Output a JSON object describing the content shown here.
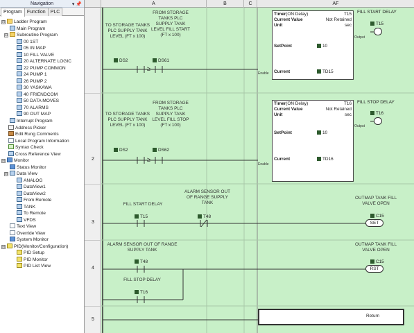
{
  "nav": {
    "title": "Navigation",
    "pin": "▾ 📌",
    "tabs": [
      "Program",
      "Function",
      "PLC"
    ],
    "tree": [
      {
        "label": "Ladder Program",
        "expander": "⊟"
      },
      {
        "label": "Main Program"
      },
      {
        "label": "Subroutine Program",
        "expander": "⊟"
      },
      {
        "label": "00 1ST"
      },
      {
        "label": "05 IN MAP"
      },
      {
        "label": "10 FILL VALVE"
      },
      {
        "label": "20 ALTERNATE LOGIC"
      },
      {
        "label": "22 PUMP COMMON"
      },
      {
        "label": "24 PUMP 1"
      },
      {
        "label": "26 PUMP 2"
      },
      {
        "label": "30 YASKAWA"
      },
      {
        "label": "40 FRIENDCOM"
      },
      {
        "label": "50 DATA MOVES"
      },
      {
        "label": "70 ALARMS"
      },
      {
        "label": "90 OUT MAP"
      },
      {
        "label": "Interrupt Program"
      },
      {
        "label": "Address Picker"
      },
      {
        "label": "Edit Rung Comments"
      },
      {
        "label": "Local Program Information"
      },
      {
        "label": "Syntax Check"
      },
      {
        "label": "Cross Reference View"
      },
      {
        "label": "Monitor",
        "expander": "⊟"
      },
      {
        "label": "Status Monitor"
      },
      {
        "label": "Data View",
        "expander": "⊟"
      },
      {
        "label": "ANALOG"
      },
      {
        "label": "DataView1"
      },
      {
        "label": "DataView2"
      },
      {
        "label": "From Remote"
      },
      {
        "label": "TANK"
      },
      {
        "label": "To Remote"
      },
      {
        "label": "VFDS"
      },
      {
        "label": "Text View"
      },
      {
        "label": "Override View"
      },
      {
        "label": "System Monitor"
      },
      {
        "label": "PID(Monitor/Configuration)",
        "expander": "⊟"
      },
      {
        "label": "PID Setup"
      },
      {
        "label": "PID Monitor"
      },
      {
        "label": "PID List View"
      }
    ]
  },
  "grid": {
    "columns": [
      "A",
      "B",
      "C",
      "AF"
    ]
  },
  "rungs": {
    "numbers": [
      "2",
      "3",
      "4",
      "5"
    ]
  },
  "rung1": {
    "comment_a": "TO STORAGE TANKS PLC SUPPLY TANK LEVEL (FT x 100)",
    "comment_b": "FROM STORAGE TANKS PLC SUPPLY TANK LEVEL FILL START (FT x 100)",
    "el_a": "DS2",
    "el_b": "DS61",
    "cmp": "≥",
    "timer_type": "Timer",
    "timer_mode": "(ON Delay)",
    "timer_id": "T15",
    "cv_label": "Current Value",
    "cv_value": "Not Retained",
    "unit_label": "Unit",
    "unit_value": "sec",
    "sp_label": "SetPoint",
    "sp_value": "10",
    "cur_label": "Current",
    "cur_value": "TD15",
    "enable": "Enable",
    "output": "Output",
    "coil_comment": "FILL START DELAY",
    "coil": "T15"
  },
  "rung2": {
    "comment_a": "TO STORAGE TANKS PLC SUPPLY TANK LEVEL (FT x 100)",
    "comment_b": "FROM STORAGE TANKS PLC SUPPLY TANK LEVEL FILL STOP (FT x 100)",
    "el_a": "DS2",
    "el_b": "DS62",
    "cmp": "≥",
    "timer_type": "Timer",
    "timer_mode": "(ON Delay)",
    "timer_id": "T16",
    "cv_label": "Current Value",
    "cv_value": "Not Retained",
    "unit_label": "Unit",
    "unit_value": "sec",
    "sp_label": "SetPoint",
    "sp_value": "10",
    "cur_label": "Current",
    "cur_value": "TD16",
    "enable": "Enable",
    "output": "Output",
    "coil_comment": "FILL STOP DELAY",
    "coil": "T16"
  },
  "rung3": {
    "c1_comment": "FILL START DELAY",
    "c1": "T15",
    "c2_comment": "ALARM SENSOR OUT OF RANGE SUPPLY TANK",
    "c2": "T48",
    "coil_comment": "OUTMAP TANK FILL VALVE OPEN",
    "coil": "C15",
    "coil_type": "SET"
  },
  "rung4": {
    "c1_comment": "ALARM SENSOR OUT OF RANGE SUPPLY TANK",
    "c1": "T48",
    "c2_comment": "FILL STOP DELAY",
    "c2": "T16",
    "coil_comment": "OUTMAP TANK FILL VALVE OPEN",
    "coil": "C15",
    "coil_type": "RST"
  },
  "rung5": {
    "return": "Return"
  }
}
